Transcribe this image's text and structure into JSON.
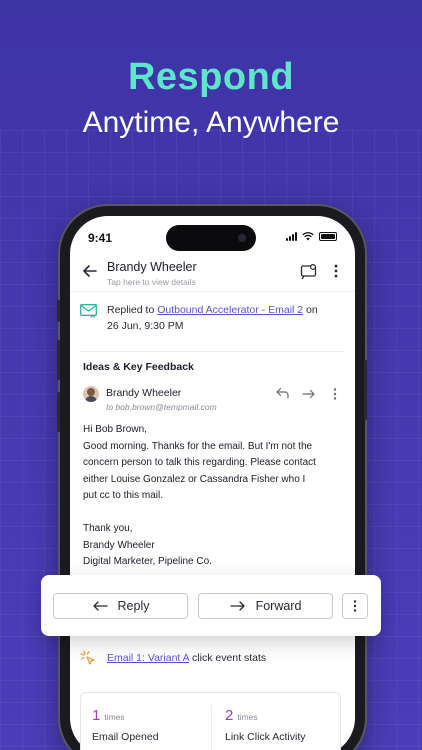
{
  "hero": {
    "title": "Respond",
    "subtitle": "Anytime, Anywhere"
  },
  "status_bar": {
    "time": "9:41"
  },
  "app_bar": {
    "contact_name": "Brandy Wheeler",
    "contact_hint": "Tap here to view details",
    "icons": [
      "back-arrow-icon",
      "contact-card-icon",
      "more-vertical-icon"
    ]
  },
  "replied_event": {
    "prefix": "Replied to",
    "link": "Outbound Accelerator - Email 2",
    "suffix": "on",
    "timestamp": "26 Jun, 9:30 PM"
  },
  "thread": {
    "subject": "Ideas & Key Feedback",
    "sender": "Brandy Wheeler",
    "to": "to bob.brown@tempmail.com",
    "body": {
      "greeting": "Hi Bob Brown,",
      "paragraph_lines": [
        "Good morning. Thanks for the email. But I'm not the",
        "concern person to talk this regarding. Please contact",
        "either Louise Gonzalez or Cassandra Fisher who I",
        "put cc to this mail."
      ],
      "signoff_lines": [
        "Thank you,",
        "Brandy Wheeler",
        "Digital Marketer, Pipeline Co."
      ]
    }
  },
  "actions": {
    "reply_label": "Reply",
    "forward_label": "Forward"
  },
  "event_stats": {
    "link": "Email 1: Variant A",
    "suffix": "click event stats",
    "stats": [
      {
        "count": "1",
        "unit": "times",
        "label": "Email Opened",
        "color": "#9b3fc0"
      },
      {
        "count": "2",
        "unit": "times",
        "label": "Link Click Activity",
        "color": "#9b3fc0"
      }
    ]
  },
  "colors": {
    "background": "#4639b0",
    "headline": "#5ee6c8",
    "link": "#5a4fcf",
    "accent_stat": "#9b3fc0",
    "replied_icon": "#2bb5a0",
    "event_icon": "#e89a3c"
  }
}
